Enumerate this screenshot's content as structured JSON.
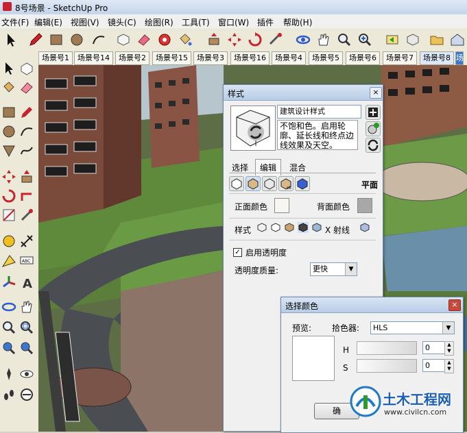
{
  "window": {
    "title": "8号场景 - SketchUp Pro"
  },
  "menu": [
    "文件(F)",
    "编辑(E)",
    "视图(V)",
    "镜头(C)",
    "绘图(R)",
    "工具(T)",
    "窗口(W)",
    "插件",
    "帮助(H)"
  ],
  "scene_tabs": [
    "场景号1",
    "场景号14",
    "场景号2",
    "场景号15",
    "场景号3",
    "场景号16",
    "场景号4",
    "场景号5",
    "场景号6",
    "场景号7",
    "场景号8"
  ],
  "styles_panel": {
    "title": "样式",
    "style_name": "建筑设计样式",
    "style_desc": "不饱和色。启用轮廓、延长线和终点边线效果及天空。",
    "tabs": [
      "选择",
      "编辑",
      "混合"
    ],
    "face_mode_label": "平面",
    "front_color_label": "正面颜色",
    "back_color_label": "背面颜色",
    "front_color": "#f8f6f2",
    "back_color": "#a8a8a8",
    "style_row_label": "样式",
    "xray_label": "X 射线",
    "enable_transparency_label": "启用透明度",
    "transparency_checked": true,
    "transparency_quality_label": "透明度质量:",
    "transparency_quality_value": "更快",
    "close": "×"
  },
  "color_picker": {
    "title": "选择颜色",
    "preview_label": "预览:",
    "picker_label": "拾色器:",
    "picker_value": "HLS",
    "h_label": "H",
    "s_label": "S",
    "h_value": "0",
    "s_value": "0",
    "ok_label": "确",
    "close": "×"
  },
  "watermark": {
    "brand": "土木工程网",
    "url": "www.civilcn.com"
  },
  "colors": {
    "accent_red": "#c8232c",
    "titlebar": "#c4d4e9",
    "dialog_bg": "#f0f0f0"
  }
}
